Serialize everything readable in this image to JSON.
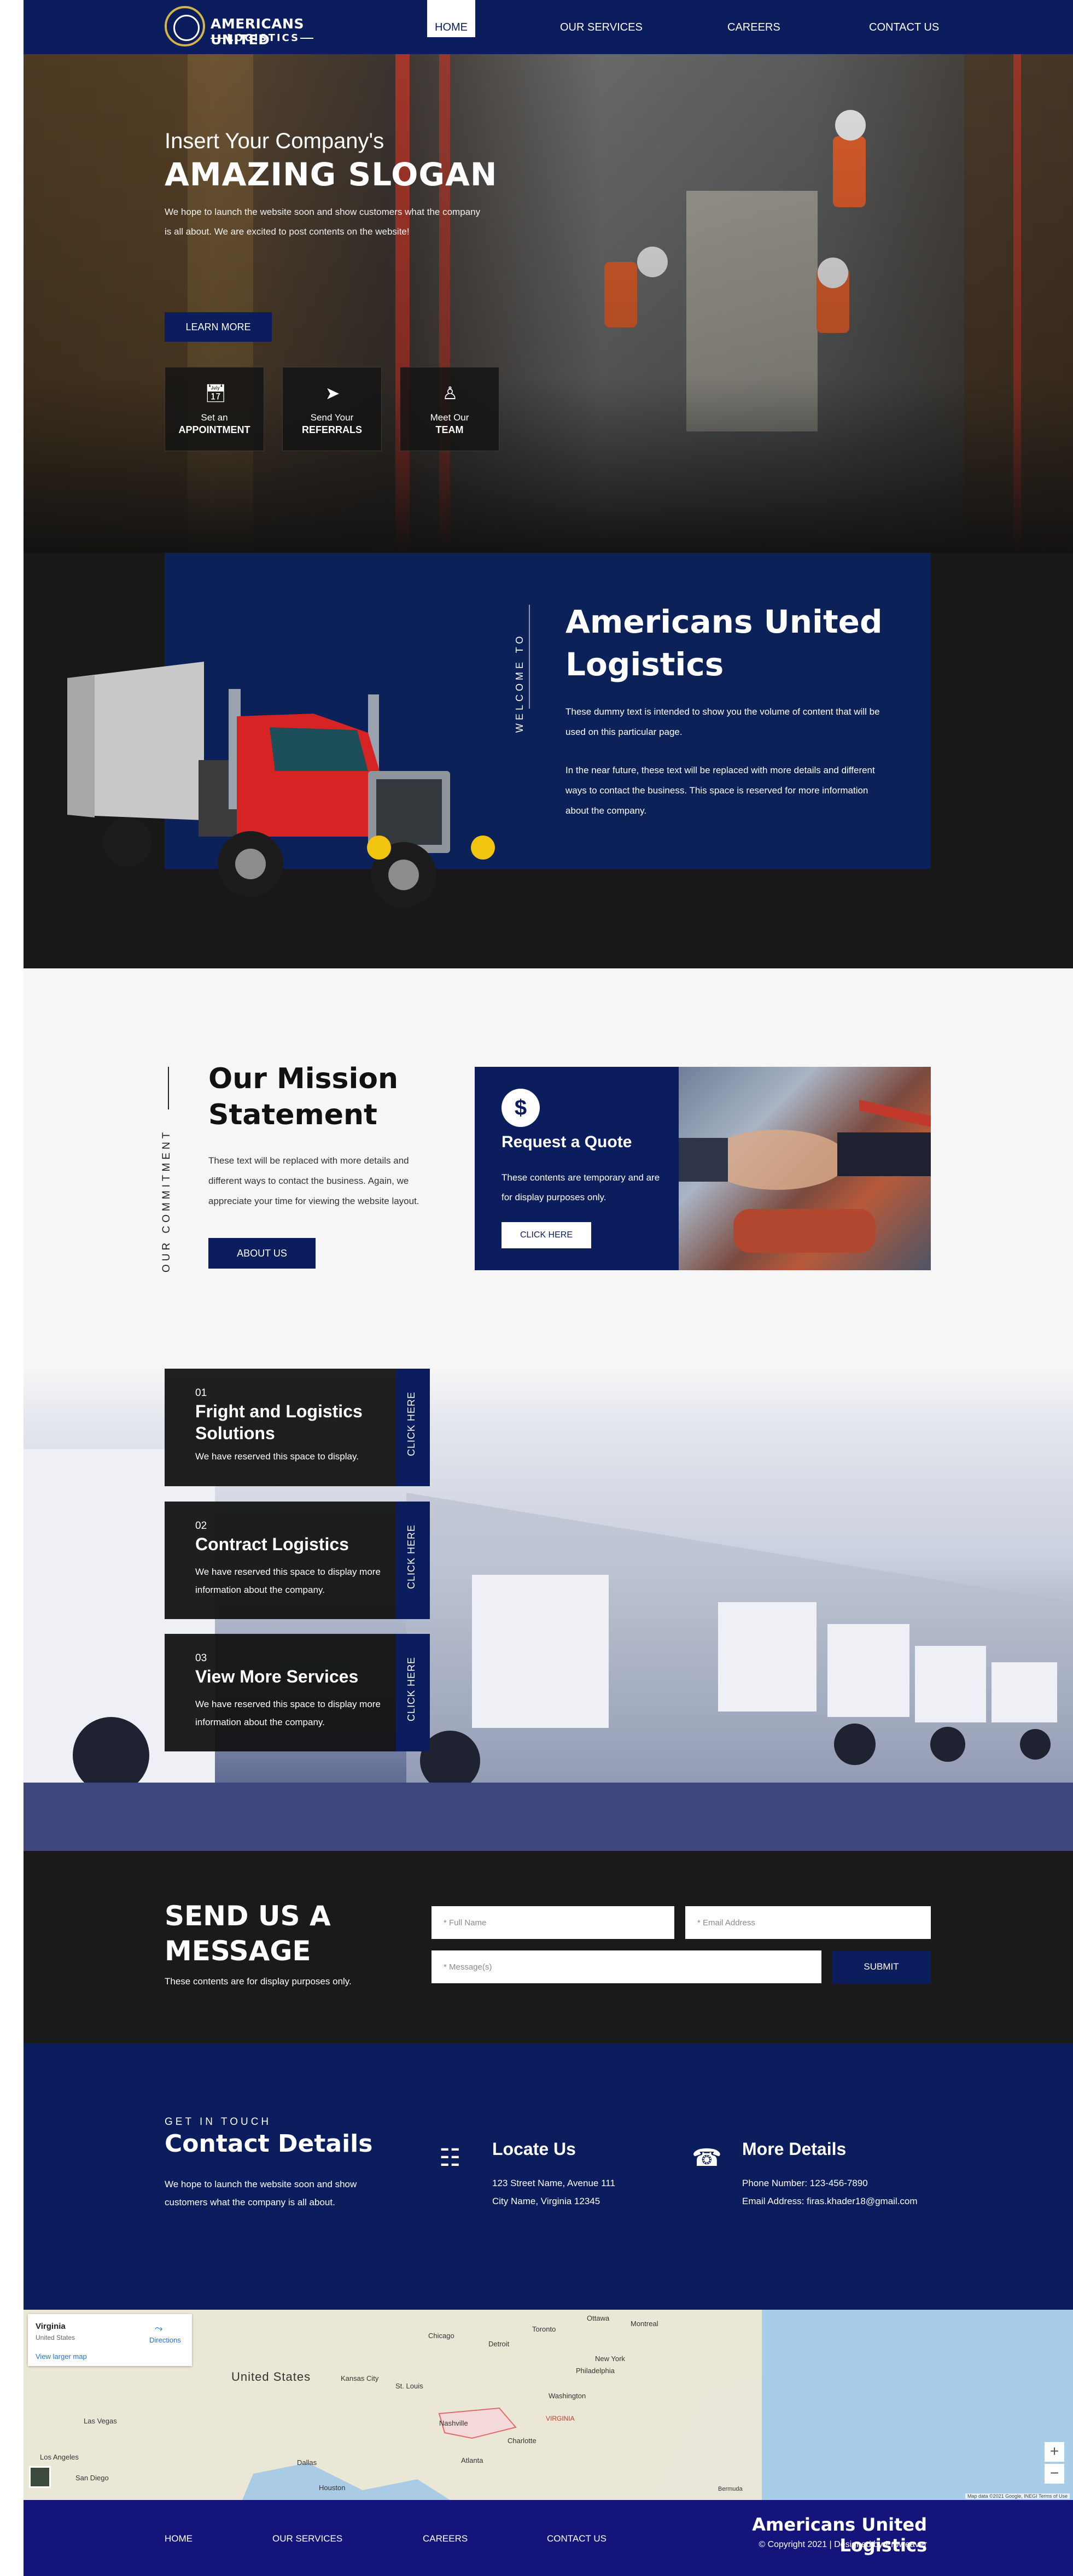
{
  "nav": {
    "logo_line1": "AMERICANS UNITED",
    "logo_line2": "LOGISTICS",
    "items": [
      "HOME",
      "OUR SERVICES",
      "CAREERS",
      "CONTACT US"
    ]
  },
  "hero": {
    "eyebrow": "Insert Your Company's",
    "title": "AMAZING SLOGAN",
    "text": "We hope to launch the website soon and show customers what the company is all about. We are excited to post contents on the website!",
    "button": "LEARN MORE",
    "cards": [
      {
        "line1": "Set an",
        "line2": "APPOINTMENT",
        "icon": "calendar-icon"
      },
      {
        "line1": "Send Your",
        "line2": "REFERRALS",
        "icon": "paper-plane-icon"
      },
      {
        "line1": "Meet Our",
        "line2": "TEAM",
        "icon": "team-icon"
      }
    ]
  },
  "welcome": {
    "vertical": "WELCOME TO",
    "title": "Americans United Logistics",
    "p1": "These dummy text is intended to show you the volume of content that will be used on this particular page.",
    "p2": "In the near future, these text will be replaced with more details and different ways to contact the business. This space is reserved for more information about the company."
  },
  "mission": {
    "vertical": "OUR COMMITMENT",
    "title": "Our Mission Statement",
    "text": "These text will be replaced with more details and different ways to contact the business. Again, we appreciate your time for viewing the website layout.",
    "button": "ABOUT US",
    "quote": {
      "icon_glyph": "$",
      "title": "Request a Quote",
      "text": "These contents are temporary and are for display purposes only.",
      "button": "CLICK HERE"
    }
  },
  "services": {
    "tab_label": "CLICK HERE",
    "items": [
      {
        "num": "01",
        "title": "Fright and Logistics Solutions",
        "desc": "We have reserved this space to display."
      },
      {
        "num": "02",
        "title": "Contract Logistics",
        "desc": "We have reserved this space to display more information about the company."
      },
      {
        "num": "03",
        "title": "View More Services",
        "desc": "We have reserved this space to display more information about the company."
      }
    ]
  },
  "form": {
    "title": "SEND US A MESSAGE",
    "subtitle": "These contents are for display purposes only.",
    "name_placeholder": "* Full Name",
    "email_placeholder": "* Email Address",
    "message_placeholder": "* Message(s)",
    "submit": "SUBMIT"
  },
  "details": {
    "eyebrow": "GET IN TOUCH",
    "title": "Contact Details",
    "text": "We hope to launch the website soon and show customers what the company is all about.",
    "locate_title": "Locate Us",
    "address1": "123 Street Name, Avenue 111",
    "address2": "City Name, Virginia 12345",
    "more_title": "More Details",
    "phone": "Phone Number:  123-456-7890",
    "email": "Email Address:  firas.khader18@gmail.com"
  },
  "map": {
    "place": "Virginia",
    "country": "United States",
    "directions": "Directions",
    "larger": "View larger map",
    "country_label": "United States",
    "cities": [
      "Kansas City",
      "St. Louis",
      "Chicago",
      "Detroit",
      "Toronto",
      "Ottawa",
      "Montreal",
      "New York",
      "Philadelphia",
      "Washington",
      "VIRGINIA",
      "Nashville",
      "Charlotte",
      "Atlanta",
      "Dallas",
      "Houston",
      "Las Vegas",
      "Los Angeles",
      "San Diego",
      "Bermuda"
    ],
    "attribution": "Map data ©2021 Google, INEGI   Terms of Use"
  },
  "footer": {
    "links": [
      "HOME",
      "OUR SERVICES",
      "CAREERS",
      "CONTACT US"
    ],
    "brand": "Americans United Logistics",
    "copyright": "© Copyright 2021  |  Designed by Proweaver"
  },
  "colors": {
    "navy": "#0b1d5c",
    "footer": "#14147a",
    "dark": "#1a1a1a"
  }
}
